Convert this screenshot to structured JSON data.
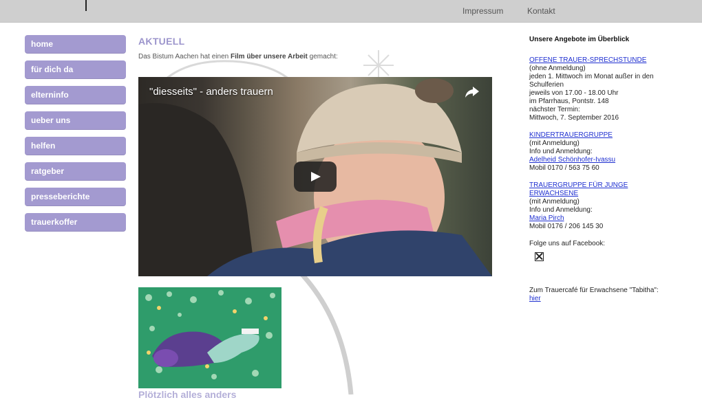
{
  "top_nav": {
    "impressum": "Impressum",
    "kontakt": "Kontakt"
  },
  "side_nav": [
    "home",
    "für dich da",
    "elterninfo",
    "ueber uns",
    "helfen",
    "ratgeber",
    "presseberichte",
    "trauerkoffer"
  ],
  "main": {
    "heading": "AKTUELL",
    "intro_prefix": "Das Bistum Aachen hat einen ",
    "intro_bold": "Film über unsere Arbeit",
    "intro_suffix": " gemacht:",
    "video_title": "\"diesseits\" - anders trauern",
    "teaser_title": "Plötzlich alles anders"
  },
  "sidebar_right": {
    "heading": "Unsere Angebote im Überblick",
    "offer1": {
      "link": "OFFENE TRAUER-SPRECHSTUNDE",
      "line1": "(ohne Anmeldung)",
      "line2": "jeden 1. Mittwoch im Monat außer in den Schulferien",
      "line3": "jeweils von 17.00 - 18.00 Uhr",
      "line4": "im Pfarrhaus, Pontstr. 148",
      "line5": "nächster Termin:",
      "line6": "Mittwoch, 7. September 2016"
    },
    "offer2": {
      "link": "KINDERTRAUERGRUPPE",
      "line1": "(mit Anmeldung)",
      "line2": "Info und Anmeldung:",
      "contact": "Adelheid Schönhofer-Ivassu",
      "phone": "Mobil 0170 / 563 75 60"
    },
    "offer3": {
      "link": "TRAUERGRUPPE FÜR JUNGE ERWACHSENE",
      "line1": "(mit Anmeldung)",
      "line2": "Info und Anmeldung:",
      "contact": "Maria Pirch",
      "phone": "Mobil 0176 / 206 145 30"
    },
    "facebook": "Folge uns auf Facebook:",
    "cafe_text": "Zum Trauercafé für Erwachsene \"Tabitha\": ",
    "cafe_link": "hier"
  }
}
